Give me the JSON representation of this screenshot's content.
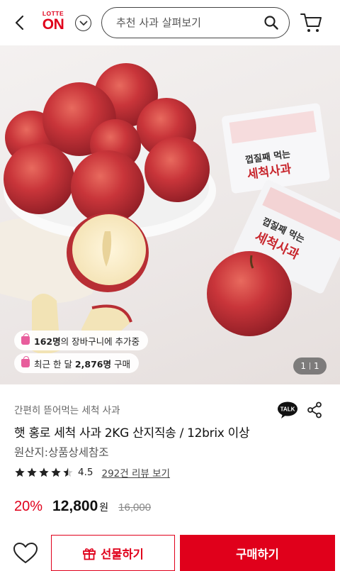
{
  "header": {
    "logo_top": "LOTTE",
    "logo_main": "ON",
    "search_placeholder": "추천 사과 살펴보기"
  },
  "image": {
    "packaging_text_1": "껍질째 먹는",
    "packaging_text_2": "세척사과",
    "badge_cart_count": "162명",
    "badge_cart_text": "의 장바구니에 추가중",
    "badge_month_prefix": "최근 한 달 ",
    "badge_month_count": "2,876명",
    "badge_month_suffix": " 구매",
    "counter_current": "1",
    "counter_total": "1"
  },
  "product": {
    "subtitle": "간편히 뜯어먹는 세척 사과",
    "title": "햇 홍로 세척 사과 2KG 산지직송 / 12brix 이상",
    "origin": "원산지:상품상세참조",
    "rating_value": 4.5,
    "rating_text": "4.5",
    "review_link": "292건 리뷰 보기",
    "discount": "20%",
    "price": "12,800",
    "currency": "원",
    "original_price": "16,000"
  },
  "actions": {
    "gift_label": "선물하기",
    "buy_label": "구매하기"
  },
  "colors": {
    "brand": "#e0001b",
    "pill_bag": "#e85d9c"
  }
}
